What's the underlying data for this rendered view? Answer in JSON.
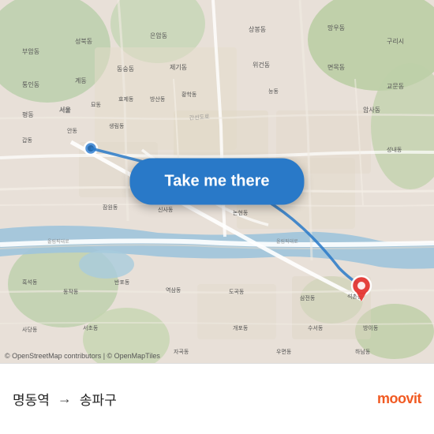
{
  "map": {
    "attribution": "© OpenStreetMap contributors | © OpenMapTiles",
    "bg_color": "#e8e0d8"
  },
  "button": {
    "label": "Take me there",
    "bg_color": "#2979c8"
  },
  "route": {
    "origin": "명동역",
    "destination": "송파구",
    "arrow": "→"
  },
  "brand": {
    "name": "moovit"
  },
  "colors": {
    "road_major": "#ffffff",
    "road_minor": "#f5f0ea",
    "green_area": "#c8dab8",
    "water": "#aaccee",
    "urban": "#e8e0d8",
    "button_blue": "#2979c8",
    "dest_red": "#e53935"
  }
}
